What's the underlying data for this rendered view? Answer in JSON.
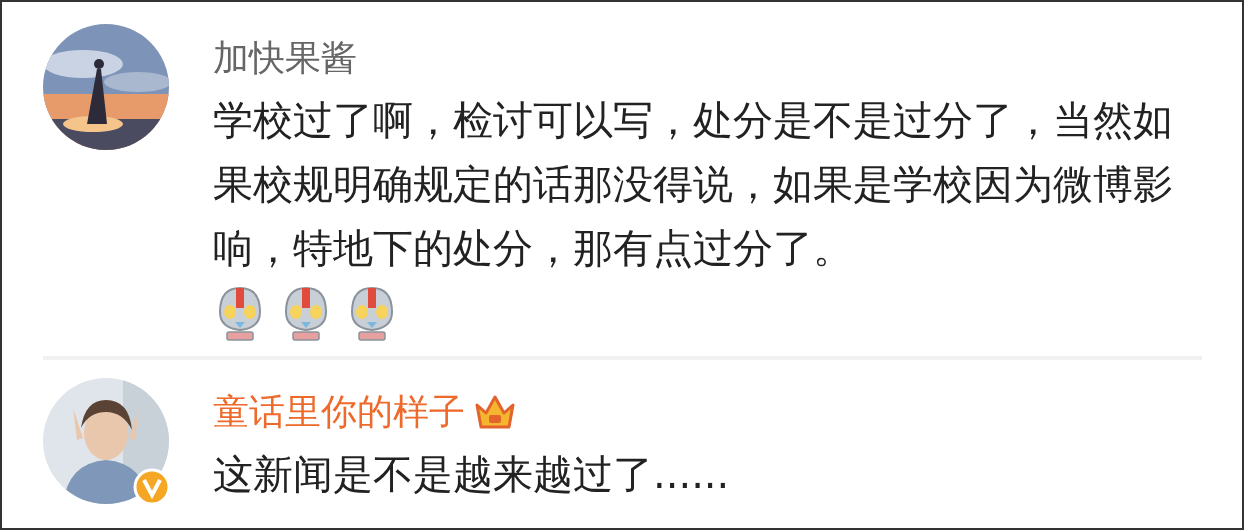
{
  "comments": [
    {
      "author": "加快果酱",
      "vip": false,
      "verified": false,
      "crown": false,
      "text": "学校过了啊，检讨可以写，处分是不是过分了，当然如果校规明确规定的话那没得说，如果是学校因为微博影响，特地下的处分，那有点过分了。",
      "emojis": [
        {
          "kind": "robot"
        },
        {
          "kind": "robot"
        },
        {
          "kind": "robot"
        }
      ]
    },
    {
      "author": "童话里你的样子",
      "vip": true,
      "verified": true,
      "crown": true,
      "text": "这新闻是不是越来越过了......"
    }
  ]
}
